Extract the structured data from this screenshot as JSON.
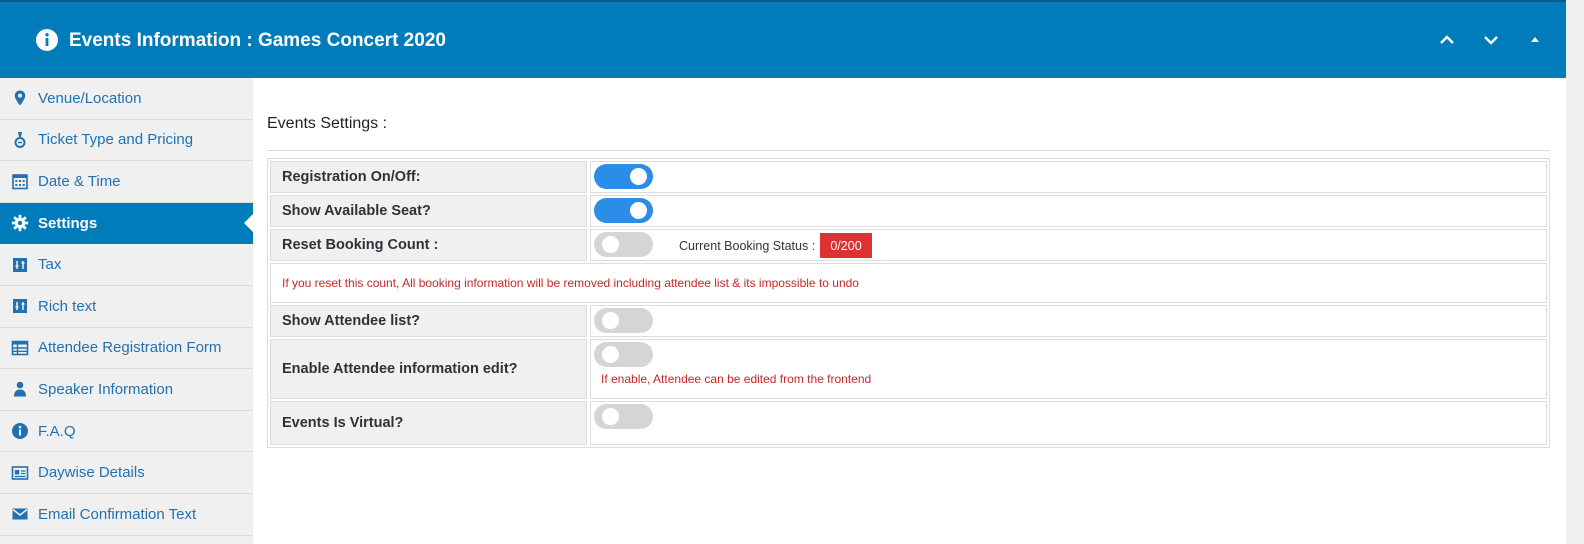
{
  "header": {
    "title": "Events Information : Games Concert 2020",
    "info_icon": "info-circle-icon",
    "controls": [
      "chevron-up-icon",
      "chevron-down-icon",
      "caret-up-icon"
    ]
  },
  "sidebar": {
    "items": [
      {
        "label": "Venue/Location",
        "icon": "map-pin-icon",
        "active": false
      },
      {
        "label": "Ticket Type and Pricing",
        "icon": "ticket-icon",
        "active": false
      },
      {
        "label": "Date & Time",
        "icon": "calendar-icon",
        "active": false
      },
      {
        "label": "Settings",
        "icon": "gear-icon",
        "active": true
      },
      {
        "label": "Tax",
        "icon": "sliders-icon",
        "active": false
      },
      {
        "label": "Rich text",
        "icon": "sliders-icon",
        "active": false
      },
      {
        "label": "Attendee Registration Form",
        "icon": "table-icon",
        "active": false
      },
      {
        "label": "Speaker Information",
        "icon": "user-icon",
        "active": false
      },
      {
        "label": "F.A.Q",
        "icon": "info-circle-icon",
        "active": false
      },
      {
        "label": "Daywise Details",
        "icon": "id-card-icon",
        "active": false
      },
      {
        "label": "Email Confirmation Text",
        "icon": "envelope-icon",
        "active": false
      }
    ]
  },
  "content": {
    "section_title": "Events Settings :",
    "rows": {
      "registration": {
        "label": "Registration On/Off:",
        "enabled": true
      },
      "available_seat": {
        "label": "Show Available Seat?",
        "enabled": true
      },
      "reset_count": {
        "label": "Reset Booking Count :",
        "enabled": false,
        "status_label": "Current Booking Status :",
        "status_value": "0/200"
      },
      "reset_warning": "If you reset this count, All booking information will be removed including attendee list & its impossible to undo",
      "attendee_list": {
        "label": "Show Attendee list?",
        "enabled": false
      },
      "attendee_edit": {
        "label": "Enable Attendee information edit?",
        "enabled": false,
        "hint": "If enable, Attendee can be edited from the frontend"
      },
      "virtual": {
        "label": "Events Is Virtual?",
        "enabled": false
      }
    }
  },
  "colors": {
    "header_bg": "#007cba",
    "active_nav_bg": "#007cba",
    "toggle_on": "#2a8ee8",
    "toggle_off": "#d5d5d5",
    "status_badge": "#dc3232",
    "warning_text": "#c62828"
  }
}
